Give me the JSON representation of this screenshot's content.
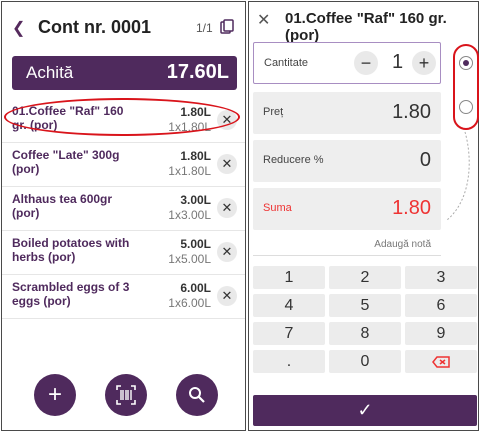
{
  "left": {
    "back_icon": "chevron-left-icon",
    "title": "Cont nr. 0001",
    "pager": "1/1",
    "copy_icon": "copy-icon",
    "pay": {
      "label": "Achită",
      "total": "17.60L"
    },
    "items": [
      {
        "name": "01.Coffee \"Raf\" 160 gr. (por)",
        "price": "1.80L",
        "qty": "1x1.80L"
      },
      {
        "name": "Coffee \"Late\" 300g (por)",
        "price": "1.80L",
        "qty": "1x1.80L"
      },
      {
        "name": "Althaus tea 600gr (por)",
        "price": "3.00L",
        "qty": "1x3.00L"
      },
      {
        "name": "Boiled potatoes with herbs (por)",
        "price": "5.00L",
        "qty": "1x5.00L"
      },
      {
        "name": "Scrambled eggs of 3 eggs (por)",
        "price": "6.00L",
        "qty": "1x6.00L"
      }
    ],
    "fabs": [
      "add-icon",
      "barcode-icon",
      "search-icon"
    ]
  },
  "right": {
    "close_icon": "close-icon",
    "title": "01.Coffee \"Raf\" 160 gr. (por)",
    "fields": {
      "quantity": {
        "label": "Cantitate",
        "value": "1"
      },
      "price": {
        "label": "Preț",
        "value": "1.80"
      },
      "discount": {
        "label": "Reducere %",
        "value": "0"
      },
      "sum": {
        "label": "Suma",
        "value": "1.80"
      }
    },
    "note": "Adaugă notă",
    "keys": [
      "1",
      "2",
      "3",
      "4",
      "5",
      "6",
      "7",
      "8",
      "9",
      ".",
      "0"
    ],
    "backspace_icon": "backspace-icon",
    "confirm_icon": "check-icon",
    "accent": "#4f2a5d",
    "alert": "#e33333"
  }
}
